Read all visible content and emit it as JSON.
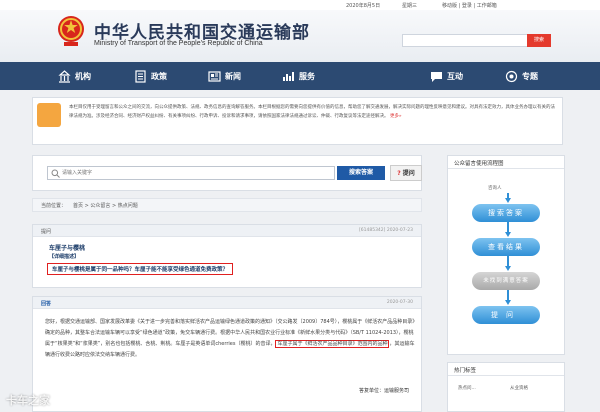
{
  "topbar": {
    "date": "2020年8月5日",
    "weekday": "星期三",
    "links": "移动版 | 登录 | 工作邮箱"
  },
  "header": {
    "title_cn": "中华人民共和国交通运输部",
    "title_en": "Ministry of Transport of the People's Republic of China",
    "search_placeholder": "",
    "search_button": "搜索"
  },
  "nav": [
    {
      "label": "机构",
      "icon": "building-icon"
    },
    {
      "label": "政策",
      "icon": "document-icon"
    },
    {
      "label": "新闻",
      "icon": "newspaper-icon"
    },
    {
      "label": "服务",
      "icon": "chart-icon"
    },
    {
      "label": "互动",
      "icon": "chat-icon"
    },
    {
      "label": "专题",
      "icon": "special-topic-icon"
    }
  ],
  "notice": {
    "text": "本栏目仅用于受理留言和公众之间的交流，向公众提供政策、法规、政务信息的查询解答服务。本栏目根据您的需要向您提供有价值的信息，帮助您了解交通发展，解决实际问题的理性反映意见和建议。对具有法定效力，具体业务办理以有关的法律法规为准。涉及经济合同、经济财产权益纠纷、有关事项纠纷、行政申诉、投诉和请求事项，请依照国家法律法规通过诉讼、仲裁、行政复议等法定途径解决。",
    "more": "更多»"
  },
  "qsearch": {
    "placeholder": "请输入关键字",
    "search_button": "搜索答案",
    "ask_button": "提问"
  },
  "breadcrumb": {
    "prefix": "当前位置：",
    "path": "首页 > 公众留言 > 热点问题"
  },
  "question": {
    "label": "提问",
    "meta": "[61485342]  2020-07-23",
    "title": "车厘子与樱桃",
    "detail_label": "【详细描述】",
    "body": "车厘子与樱桃是属于同一品种吗？车厘子能不能享受绿色通道免费政策？"
  },
  "answer": {
    "label": "回答",
    "date": "2020-07-30",
    "text_before": "您好，根据交通运输部、国家发展改革委《关于进一步完善和落实鲜活农产品运输绿色通道政策的通知》（交公路发〔2009〕784号），樱桃属于《鲜活农产品品种目录》确定的品种，其整车合法运输车辆可以享受“绿色通道”政策，免交车辆通行费。根据中华人民共和国农业行业标准《新鲜水果分类与代码》（SB/T 11024-2013），樱桃属于“核果类”和“浆果类”，别名也包括樱桃、含桃、荆桃。车厘子是英语单词cherries（樱桃）的音译，",
    "highlight": "车厘子属于《鲜活农产品品种目录》范围内的品种",
    "text_after": "，其运输车辆通行收费公路时应依法交纳车辆通行费。",
    "sign_label": "答复单位：",
    "sign_value": "运输服务司"
  },
  "flow": {
    "title": "公众留言使用流程图",
    "start_label": "咨询人",
    "steps": [
      "搜索答案",
      "查看结果",
      "未找到满意答案",
      "提问"
    ]
  },
  "hot": {
    "title": "热门标签",
    "tags": [
      "热点问...",
      "从业资格"
    ]
  },
  "watermark": "卡车之家",
  "colors": {
    "nav": "#2c4a72",
    "accent_red": "#e43a2d",
    "button_blue": "#1f5aa6",
    "flow_blue": "#2f8fd6"
  }
}
